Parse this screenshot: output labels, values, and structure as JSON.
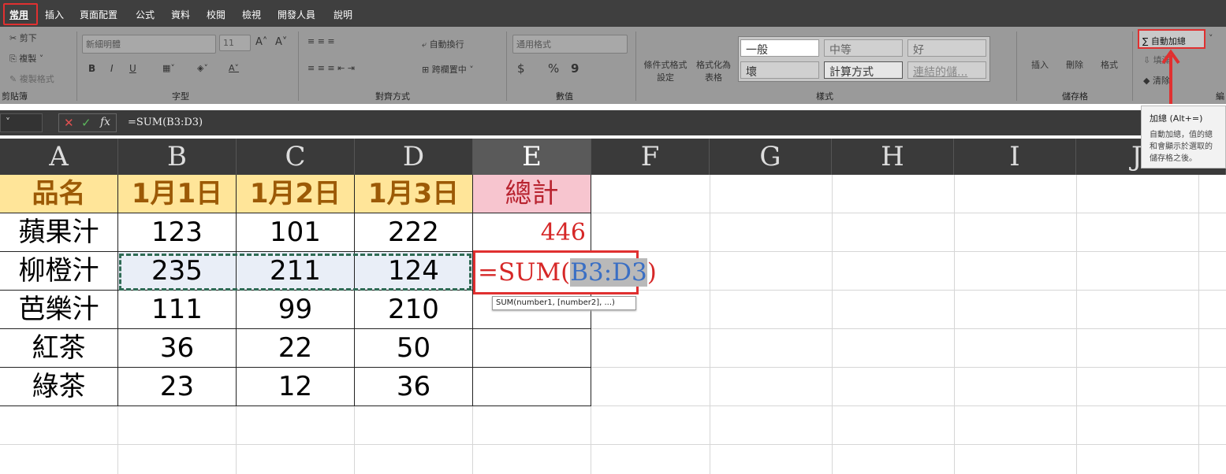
{
  "menu": [
    "常用",
    "插入",
    "頁面配置",
    "公式",
    "資料",
    "校閱",
    "檢視",
    "開發人員",
    "說明"
  ],
  "ribbon": {
    "clipboard": {
      "cut": "剪下",
      "copy": "複製",
      "format_painter": "複製格式",
      "label": "剪貼簿"
    },
    "font": {
      "name": "新細明體",
      "size": "11",
      "grow": "A˄",
      "shrink": "A˅",
      "bold": "B",
      "italic": "I",
      "underline": "U",
      "label": "字型"
    },
    "align": {
      "wrap": "自動換行",
      "merge": "跨欄置中",
      "label": "對齊方式"
    },
    "number": {
      "format": "通用格式",
      "currency": "$",
      "percent": "%",
      "comma": "9",
      "label": "數值"
    },
    "styles": {
      "conditional": "條件式格式設定",
      "table": "格式化為表格",
      "normal": "一般",
      "neutral": "中等",
      "good": "好",
      "bad": "壞",
      "calc": "計算方式",
      "link": "連結的儲...",
      "label": "樣式"
    },
    "cells": {
      "insert": "插入",
      "delete": "刪除",
      "format": "格式",
      "label": "儲存格"
    },
    "editing": {
      "autosum": "∑ 自動加總",
      "fill": "填滿",
      "clear": "清除",
      "label": "編"
    }
  },
  "tooltip": {
    "title": "加總 (Alt+=)",
    "body": "自動加總，值的總和會顯示於選取的儲存格之後。"
  },
  "formula_bar": {
    "fx": "fx",
    "value": "=SUM(B3:D3)"
  },
  "columns": [
    "A",
    "B",
    "C",
    "D",
    "E",
    "F",
    "G",
    "H",
    "I",
    "J"
  ],
  "header_row": [
    "品名",
    "1月1日",
    "1月2日",
    "1月3日",
    "總計"
  ],
  "rows": [
    {
      "name": "蘋果汁",
      "b": "123",
      "c": "101",
      "d": "222",
      "e": "446"
    },
    {
      "name": "柳橙汁",
      "b": "235",
      "c": "211",
      "d": "124",
      "e": "=SUM(B3:D3)"
    },
    {
      "name": "芭樂汁",
      "b": "111",
      "c": "99",
      "d": "210",
      "e": ""
    },
    {
      "name": "紅茶",
      "b": "36",
      "c": "22",
      "d": "50",
      "e": ""
    },
    {
      "name": "綠茶",
      "b": "23",
      "c": "12",
      "d": "36",
      "e": ""
    }
  ],
  "edit_formula": {
    "prefix": "=SUM(",
    "ref": "B3:D3",
    "suffix": ")"
  },
  "func_hint": "SUM(number1, [number2], ...)",
  "colors": {
    "header_fill": "#ffe599",
    "total_fill": "#f7c5cf",
    "highlight": "#e03030"
  }
}
